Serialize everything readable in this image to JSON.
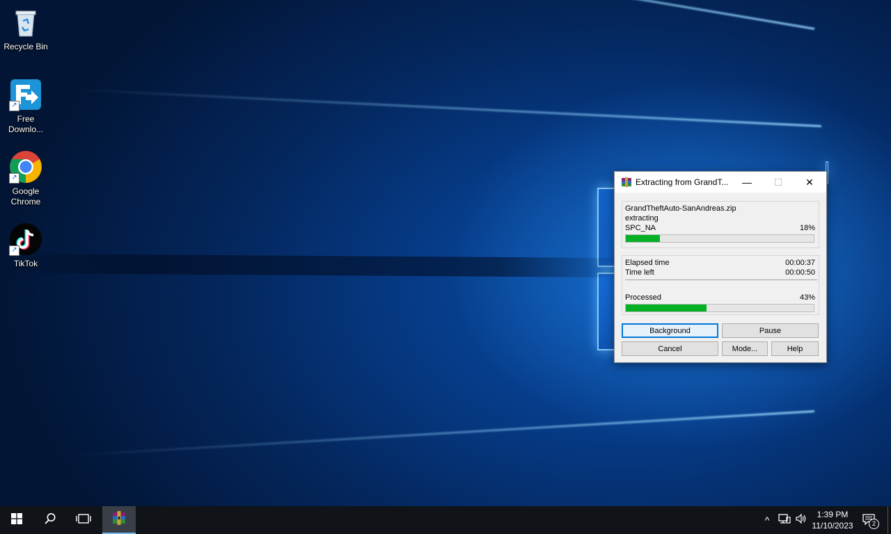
{
  "desktop": {
    "icons": [
      {
        "label": "Recycle Bin",
        "icon": "recycle-bin-icon"
      },
      {
        "label": "Free Downlo...",
        "icon": "free-download-manager-icon"
      },
      {
        "label": "Google Chrome",
        "icon": "chrome-icon"
      },
      {
        "label": "TikTok",
        "icon": "tiktok-icon"
      }
    ]
  },
  "dialog": {
    "title": "Extracting from GrandT...",
    "archive_name": "GrandTheftAuto-SanAndreas.zip",
    "action": "extracting",
    "current_file": "SPC_NA",
    "file_percent": "18%",
    "file_progress": 0.18,
    "elapsed_label": "Elapsed time",
    "elapsed_value": "00:00:37",
    "time_left_label": "Time left",
    "time_left_value": "00:00:50",
    "processed_label": "Processed",
    "processed_percent": "43%",
    "processed_progress": 0.43,
    "buttons": {
      "background": "Background",
      "pause": "Pause",
      "cancel": "Cancel",
      "mode": "Mode...",
      "help": "Help"
    },
    "controls": {
      "minimize": "—",
      "maximize": "☐",
      "close": "✕"
    }
  },
  "taskbar": {
    "start_icon": "windows-start-icon",
    "search_icon": "search-icon",
    "task_view_icon": "task-view-icon",
    "active_app_icon": "winrar-icon",
    "tray": {
      "chevron": "^",
      "notification_count": "2"
    },
    "clock": {
      "time": "1:39 PM",
      "date": "11/10/2023"
    }
  },
  "colors": {
    "progress_fill": "#06b025",
    "accent": "#0078d7",
    "taskbar": "#101318"
  }
}
